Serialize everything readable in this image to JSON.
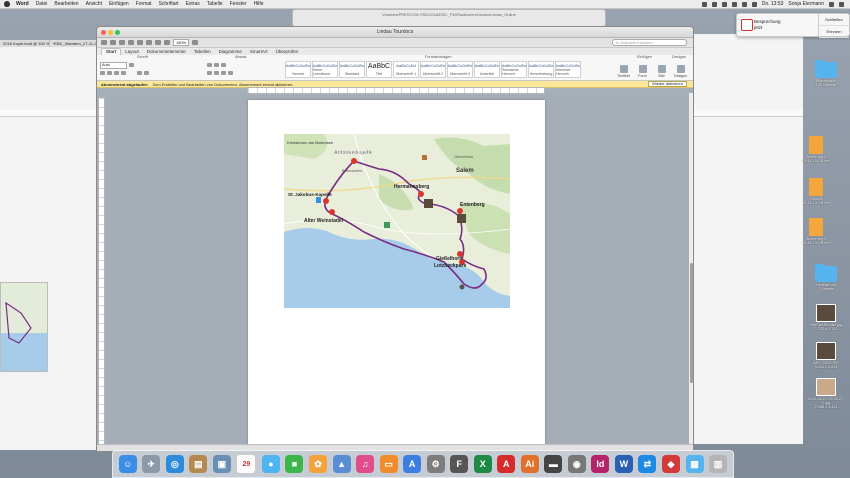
{
  "menubar": {
    "app": "Word",
    "items": [
      "Datei",
      "Bearbeiten",
      "Ansicht",
      "Einfügen",
      "Format",
      "Schriftart",
      "Extras",
      "Tabelle",
      "Fenster",
      "Hilfe"
    ],
    "clock": "Do. 13:53",
    "user": "Sonja Eiermann"
  },
  "background_windows": {
    "left_tabs": [
      "2018 Kopie.indd @ 100 %",
      "*EBC_Wandern_27-11-2..."
    ],
    "top_path": "Volumes/PRESCOM SSD/2018/EBC_FW/Radtouren/Lindau/Lindau_Online"
  },
  "window": {
    "title": "Lindau Tourdocs",
    "zoom": "180%",
    "search_placeholder": "In Dokument suchen",
    "tabs": [
      "Start",
      "Layout",
      "Dokumentelemente",
      "Tabellen",
      "Diagramme",
      "SmartArt",
      "Überprüfen"
    ],
    "active_tab": "Start",
    "groups": [
      "Schrift",
      "Absatz",
      "Formatvorlagen",
      "Einfügen",
      "Designs"
    ],
    "font": "Arial",
    "styles": [
      {
        "sample": "AaBbCcDdEe",
        "name": "Normal"
      },
      {
        "sample": "AaBbCcDdEe",
        "name": "Keine Leerräume"
      },
      {
        "sample": "AaBbCcDdEe",
        "name": "Standard"
      },
      {
        "sample": "AaBbC",
        "name": "Titel"
      },
      {
        "sample": "AaBbCcDd",
        "name": "Überschrift 1"
      },
      {
        "sample": "AaBbCcDdEe",
        "name": "Überschrift 2"
      },
      {
        "sample": "AaBbCcDdEe",
        "name": "Überschrift 3"
      },
      {
        "sample": "AaBbCcDdEe",
        "name": "Untertitel"
      },
      {
        "sample": "AaBbCcDdEe",
        "name": "Schwache Hervorh."
      },
      {
        "sample": "AaBbCcDdEe",
        "name": "Hervorhebung"
      },
      {
        "sample": "AaBbCcDdEe",
        "name": "Intensive Hervorh."
      }
    ],
    "right_buttons": [
      "Textfeld",
      "Form",
      "Bild",
      "Designs"
    ],
    "message": {
      "bold": "Abonnement abgelaufen",
      "text": "Zum Erstellen und Bearbeiten von Dokumenten, Abonnement erneut aktivieren.",
      "action": "Wieder aktivieren"
    }
  },
  "map": {
    "labels": [
      {
        "text": "Kressbronn am Bodensee",
        "kind": "small"
      },
      {
        "text": "Antoniuskapelle",
        "kind": "poi"
      },
      {
        "text": "Bettenschen",
        "kind": "small"
      },
      {
        "text": "Oberreitnau",
        "kind": "small"
      },
      {
        "text": "Salem",
        "kind": "place"
      },
      {
        "text": "Hermannsberg",
        "kind": "poi"
      },
      {
        "text": "St. Jakobus-Kapelle",
        "kind": "poi"
      },
      {
        "text": "Entenberg",
        "kind": "poi"
      },
      {
        "text": "Alter Weinstadel",
        "kind": "poi"
      },
      {
        "text": "Gießelhorn",
        "kind": "poi"
      },
      {
        "text": "Lotzbeckpark",
        "kind": "poi"
      }
    ]
  },
  "notification": {
    "line1": "Besprechung",
    "line2": "jetzt",
    "button1": "Schließen",
    "button2": "Erinnern"
  },
  "desktop_icons": [
    {
      "label": "Schreibtisch",
      "sub": "150 Objekte",
      "type": "folder"
    },
    {
      "label": "Sicherung 2",
      "sub": "09.11...5 GB frei",
      "type": "drive"
    },
    {
      "label": "Sonnlit",
      "sub": "30.11...3 GB frei",
      "type": "drive"
    },
    {
      "label": "Sicherung 1",
      "sub": "30.11...3 GB frei",
      "type": "drive"
    },
    {
      "label": "Hintergrund",
      "sub": "7 Objekte",
      "type": "folder"
    },
    {
      "label": "FaltSizeRender.jpg",
      "sub": "2.732 x 2.732",
      "type": "photo"
    },
    {
      "label": "IMG_2225.JPG",
      "sub": "3.024 x 3.024",
      "type": "photo"
    },
    {
      "label": "2012-06-17 09.36.27-2.jpg",
      "sub": "2.088 x 3.411",
      "type": "photo"
    }
  ],
  "dock": [
    {
      "name": "finder",
      "glyph": "☺",
      "color": "#3a8ee6"
    },
    {
      "name": "launchpad",
      "glyph": "✈",
      "color": "#8c99a8"
    },
    {
      "name": "safari",
      "glyph": "◎",
      "color": "#2d8bd9"
    },
    {
      "name": "notes-app",
      "glyph": "▤",
      "color": "#b58a4e"
    },
    {
      "name": "preview",
      "glyph": "▣",
      "color": "#6a8fb4"
    },
    {
      "name": "calendar",
      "glyph": "29",
      "color": "#ffffff"
    },
    {
      "name": "messages",
      "glyph": "●",
      "color": "#4fb4f2"
    },
    {
      "name": "facetime",
      "glyph": "■",
      "color": "#3cb54a"
    },
    {
      "name": "photos",
      "glyph": "✿",
      "color": "#f4a23c"
    },
    {
      "name": "keynote",
      "glyph": "▲",
      "color": "#5a8ed4"
    },
    {
      "name": "itunes",
      "glyph": "♫",
      "color": "#e04d8a"
    },
    {
      "name": "ibooks",
      "glyph": "▭",
      "color": "#f08c2a"
    },
    {
      "name": "app-store",
      "glyph": "A",
      "color": "#3c7fe0"
    },
    {
      "name": "system-preferences",
      "glyph": "⚙",
      "color": "#7d7d7d"
    },
    {
      "name": "font-book",
      "glyph": "F",
      "color": "#555555"
    },
    {
      "name": "excel",
      "glyph": "X",
      "color": "#1f8a45"
    },
    {
      "name": "acrobat",
      "glyph": "A",
      "color": "#d62b2b"
    },
    {
      "name": "illustrator",
      "glyph": "Ai",
      "color": "#e0702a"
    },
    {
      "name": "printer",
      "glyph": "▬",
      "color": "#444444"
    },
    {
      "name": "disk-utility",
      "glyph": "◉",
      "color": "#777777"
    },
    {
      "name": "indesign",
      "glyph": "Id",
      "color": "#b5246b"
    },
    {
      "name": "word",
      "glyph": "W",
      "color": "#2b5fb4"
    },
    {
      "name": "teamviewer",
      "glyph": "⇄",
      "color": "#1e88e5"
    },
    {
      "name": "prescom",
      "glyph": "◆",
      "color": "#d33a3a"
    },
    {
      "name": "downloads-folder",
      "glyph": "▦",
      "color": "#55b4ee"
    },
    {
      "name": "trash",
      "glyph": "▥",
      "color": "#b5b5b5"
    }
  ]
}
